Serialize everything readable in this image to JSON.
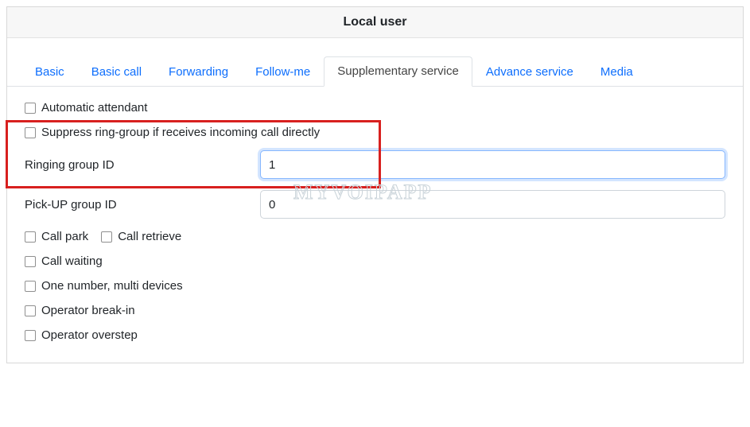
{
  "header": {
    "title": "Local user"
  },
  "tabs": [
    {
      "label": "Basic"
    },
    {
      "label": "Basic call"
    },
    {
      "label": "Forwarding"
    },
    {
      "label": "Follow-me"
    },
    {
      "label": "Supplementary service"
    },
    {
      "label": "Advance service"
    },
    {
      "label": "Media"
    }
  ],
  "activeTabIndex": 4,
  "form": {
    "automatic_attendant": "Automatic attendant",
    "suppress_ring_group": "Suppress ring-group if receives incoming call directly",
    "ringing_group_id": {
      "label": "Ringing group ID",
      "value": "1"
    },
    "pickup_group_id": {
      "label": "Pick-UP group ID",
      "value": "0"
    },
    "call_park": "Call park",
    "call_retrieve": "Call retrieve",
    "call_waiting": "Call waiting",
    "one_number_multi_devices": "One number, multi devices",
    "operator_break_in": "Operator break-in",
    "operator_overstep": "Operator overstep"
  },
  "watermark": "MYVOIPAPP"
}
